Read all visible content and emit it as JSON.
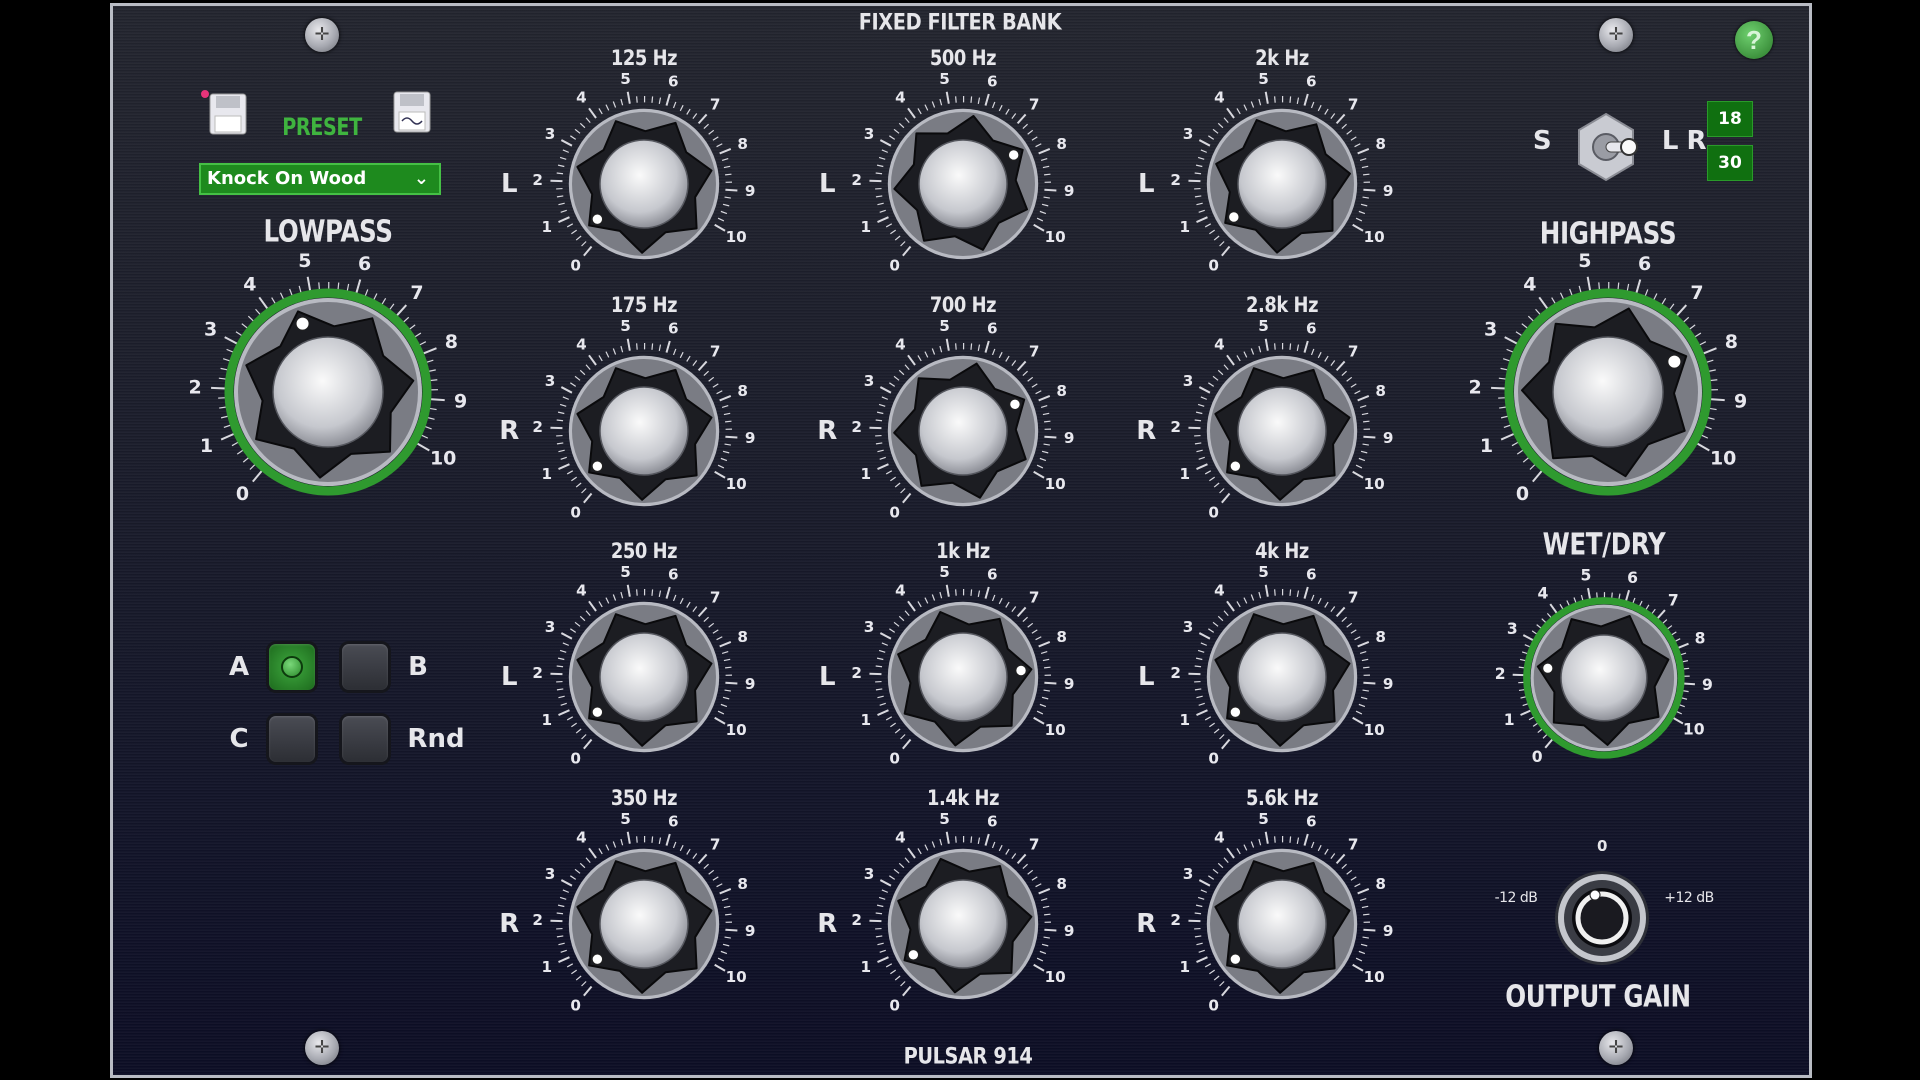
{
  "header": {
    "title": "FIXED FILTER BANK",
    "product": "PULSAR 914",
    "help_icon": "question-mark-icon",
    "help_label": "?"
  },
  "preset": {
    "label": "PRESET",
    "selected": "Knock On Wood",
    "load_icon": "floppy-disk-icon",
    "save_icon": "floppy-disk-icon"
  },
  "stereo": {
    "s_label": "S",
    "lr_label": "L R",
    "badge_top": "18",
    "badge_bottom": "30"
  },
  "scale_labels": [
    "0",
    "1",
    "2",
    "3",
    "4",
    "5",
    "6",
    "7",
    "8",
    "9",
    "10"
  ],
  "lowpass": {
    "label": "LOWPASS",
    "value": 4.6
  },
  "highpass": {
    "label": "HIGHPASS",
    "value": 7.9
  },
  "wetdry": {
    "label": "WET/DRY",
    "value": 2.3
  },
  "output_gain": {
    "label": "OUTPUT GAIN",
    "min_label": "-12 dB",
    "max_label": "+12 dB",
    "center_label": "0",
    "value_db": -1.5
  },
  "ab_slots": [
    {
      "label": "A",
      "active": true
    },
    {
      "label": "B",
      "active": false
    },
    {
      "label": "C",
      "active": false
    },
    {
      "label": "Rnd",
      "active": false
    }
  ],
  "bands": [
    {
      "freq": "125 Hz",
      "channel": "L",
      "value": 0.5
    },
    {
      "freq": "175 Hz",
      "channel": "R",
      "value": 0.5
    },
    {
      "freq": "250 Hz",
      "channel": "L",
      "value": 0.5
    },
    {
      "freq": "350 Hz",
      "channel": "R",
      "value": 0.5
    },
    {
      "freq": "500 Hz",
      "channel": "L",
      "value": 7.7
    },
    {
      "freq": "700 Hz",
      "channel": "R",
      "value": 7.8
    },
    {
      "freq": "1k Hz",
      "channel": "L",
      "value": 8.6
    },
    {
      "freq": "1.4k Hz",
      "channel": "R",
      "value": 0.7
    },
    {
      "freq": "2k Hz",
      "channel": "L",
      "value": 0.6
    },
    {
      "freq": "2.8k Hz",
      "channel": "R",
      "value": 0.5
    },
    {
      "freq": "4k Hz",
      "channel": "L",
      "value": 0.5
    },
    {
      "freq": "5.6k Hz",
      "channel": "R",
      "value": 0.5
    }
  ],
  "colors": {
    "accent_green": "#3fb43f",
    "ring_green": "#2f9a2f",
    "select_bg": "#1e8a1e"
  }
}
